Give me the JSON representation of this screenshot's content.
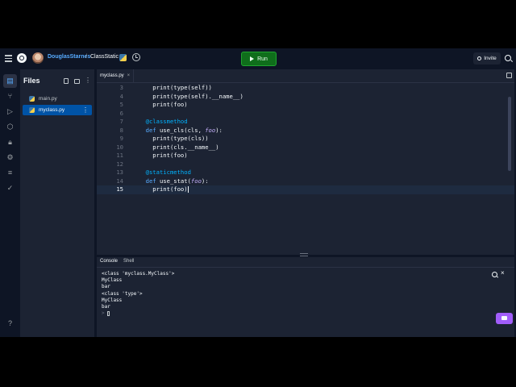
{
  "header": {
    "user": "DouglasStarnes",
    "separator": "/",
    "repl_name": "ClassStatic",
    "run_label": "Run",
    "invite_label": "Invite"
  },
  "rail": {
    "icons": [
      "files-icon",
      "git-icon",
      "console-icon",
      "packages-icon",
      "secrets-icon",
      "settings-icon",
      "database-icon",
      "check-icon",
      "help-icon"
    ],
    "help_label": "?"
  },
  "files": {
    "title": "Files",
    "items": [
      {
        "name": "main.py",
        "selected": false
      },
      {
        "name": "myclass.py",
        "selected": true
      }
    ]
  },
  "editor": {
    "tab_label": "myclass.py",
    "tab_close": "×",
    "current_line": 15,
    "lines": [
      {
        "n": "3",
        "text": "    print(type(self))"
      },
      {
        "n": "4",
        "text": "    print(type(self).__name__)"
      },
      {
        "n": "5",
        "text": "    print(foo)"
      },
      {
        "n": "6",
        "text": ""
      },
      {
        "n": "7",
        "text": "  @classmethod"
      },
      {
        "n": "8",
        "text": "  def use_cls(cls, foo):"
      },
      {
        "n": "9",
        "text": "    print(type(cls))"
      },
      {
        "n": "10",
        "text": "    print(cls.__name__)"
      },
      {
        "n": "11",
        "text": "    print(foo)"
      },
      {
        "n": "12",
        "text": ""
      },
      {
        "n": "13",
        "text": "  @staticmethod"
      },
      {
        "n": "14",
        "text": "  def use_stat(foo):"
      },
      {
        "n": "15",
        "text": "    print(foo)"
      }
    ]
  },
  "console": {
    "tabs": [
      "Console",
      "Shell"
    ],
    "close": "×",
    "prompt": ">",
    "output": [
      "<class 'myclass.MyClass'>",
      "MyClass",
      "bar",
      "<class 'type'>",
      "MyClass",
      "bar"
    ]
  },
  "colors": {
    "background": "#0e1525",
    "panel": "#1c2333",
    "accent": "#0053a6",
    "run_green": "#0f6e1b",
    "chat_purple": "#a15dfa"
  }
}
